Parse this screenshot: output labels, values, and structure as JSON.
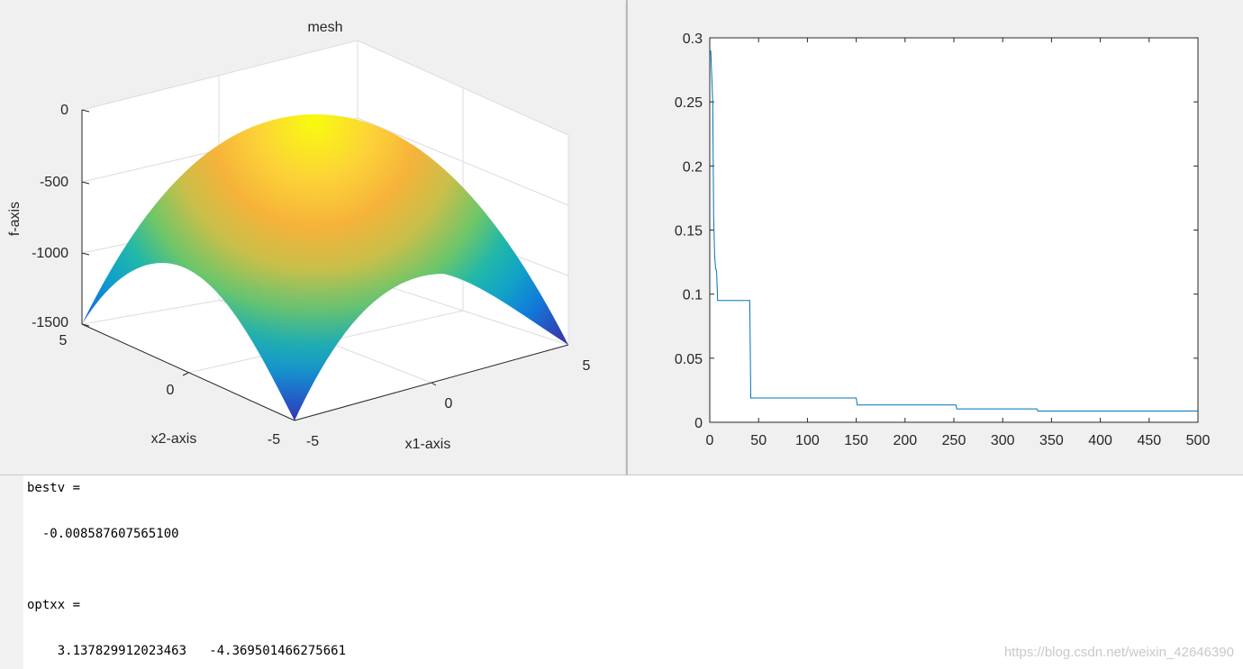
{
  "colors": {
    "figure_bg": "#f0f0f0",
    "axes_bg": "#ffffff",
    "line": "#0072bd",
    "text": "#262626",
    "grid": "#dcdcdc"
  },
  "figure1": {
    "title": "mesh",
    "xlabel": "x1-axis",
    "ylabel": "x2-axis",
    "zlabel": "f-axis",
    "x_ticks": [
      "-5",
      "0",
      "5"
    ],
    "y_ticks": [
      "-5",
      "0",
      "5"
    ],
    "z_ticks": [
      "-1500",
      "-1000",
      "-500",
      "0"
    ]
  },
  "figure2": {
    "x_ticks": [
      "0",
      "50",
      "100",
      "150",
      "200",
      "250",
      "300",
      "350",
      "400",
      "450",
      "500"
    ],
    "y_ticks": [
      "0",
      "0.05",
      "0.1",
      "0.15",
      "0.2",
      "0.25",
      "0.3"
    ]
  },
  "chart_data": [
    {
      "type": "surface",
      "title": "mesh",
      "xlabel": "x1-axis",
      "ylabel": "x2-axis",
      "zlabel": "f-axis",
      "xlim": [
        -5,
        5
      ],
      "ylim": [
        -5,
        5
      ],
      "zlim": [
        -1500,
        0
      ],
      "colormap": "parula",
      "grid": true
    },
    {
      "type": "line",
      "xlim": [
        0,
        500
      ],
      "ylim": [
        0,
        0.3
      ],
      "x": [
        1,
        3,
        4,
        5,
        6,
        7,
        8,
        41,
        42,
        150,
        151,
        252,
        253,
        335,
        336,
        500
      ],
      "y": [
        0.29,
        0.25,
        0.16,
        0.13,
        0.12,
        0.118,
        0.095,
        0.095,
        0.019,
        0.019,
        0.0135,
        0.0135,
        0.0105,
        0.0105,
        0.0088,
        0.0088
      ],
      "series": [
        {
          "name": "",
          "color": "#0072bd"
        }
      ]
    }
  ],
  "console": {
    "lines": [
      "bestv =",
      "  -0.008587607565100",
      "optxx =",
      "    3.137829912023463   -4.369501466275661"
    ]
  },
  "watermark": "https://blog.csdn.net/weixin_42646390"
}
